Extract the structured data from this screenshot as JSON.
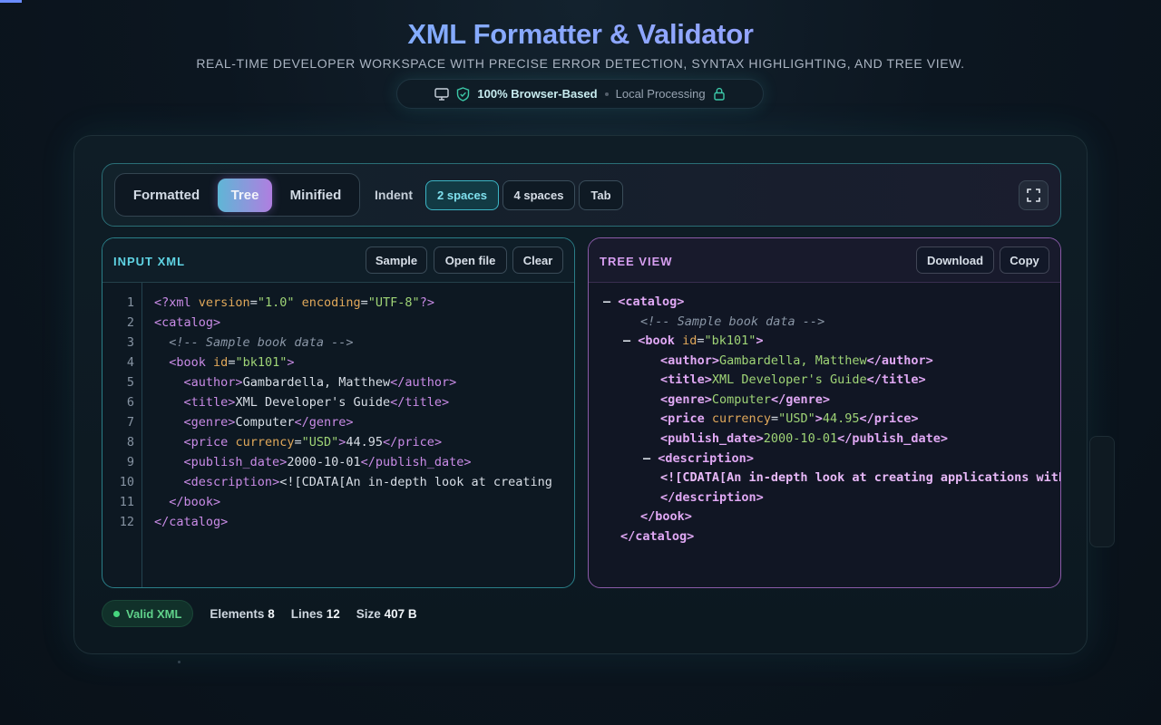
{
  "header": {
    "title": "XML Formatter & Validator",
    "subtitle": "REAL-TIME DEVELOPER WORKSPACE WITH PRECISE ERROR DETECTION, SYNTAX HIGHLIGHTING, AND TREE VIEW.",
    "badge_primary": "100% Browser-Based",
    "badge_secondary": "Local Processing"
  },
  "toolbar": {
    "modes": [
      "Formatted",
      "Tree",
      "Minified"
    ],
    "active_mode": "Tree",
    "indent_label": "Indent",
    "indent_options": [
      "2 spaces",
      "4 spaces",
      "Tab"
    ],
    "active_indent": "2 spaces"
  },
  "input_panel": {
    "title": "INPUT XML",
    "buttons": [
      "Sample",
      "Open file",
      "Clear"
    ],
    "line_numbers": [
      "1",
      "2",
      "3",
      "4",
      "5",
      "6",
      "7",
      "8",
      "9",
      "10",
      "11",
      "12"
    ],
    "lines": [
      "<?xml version=\"1.0\" encoding=\"UTF-8\"?>",
      "<catalog>",
      "  <!-- Sample book data -->",
      "  <book id=\"bk101\">",
      "    <author>Gambardella, Matthew</author>",
      "    <title>XML Developer's Guide</title>",
      "    <genre>Computer</genre>",
      "    <price currency=\"USD\">44.95</price>",
      "    <publish_date>2000-10-01</publish_date>",
      "    <description><![CDATA[An in-depth look at creating",
      "  </book>",
      "</catalog>"
    ]
  },
  "tree_panel": {
    "title": "TREE VIEW",
    "buttons": [
      "Download",
      "Copy"
    ],
    "nodes": {
      "catalog_open": "<catalog>",
      "comment": "<!-- Sample book data -->",
      "book_open_tag": "<book",
      "book_attr": "id",
      "book_attr_value": "\"bk101\"",
      "author_open": "<author>",
      "author_text": "Gambardella, Matthew",
      "author_close": "</author>",
      "title_open": "<title>",
      "title_text": "XML Developer's Guide",
      "title_close": "</title>",
      "genre_open": "<genre>",
      "genre_text": "Computer",
      "genre_close": "</genre>",
      "price_open_tag": "<price",
      "price_attr": "currency",
      "price_attr_value": "\"USD\"",
      "price_text": "44.95",
      "price_close": "</price>",
      "publish_open": "<publish_date>",
      "publish_text": "2000-10-01",
      "publish_close": "</publish_date>",
      "description_open": "<description>",
      "cdata": "<![CDATA[An in-depth look at creating applications with",
      "description_close": "</description>",
      "book_close": "</book>",
      "catalog_close": "</catalog>",
      "collapse_marker": "–"
    }
  },
  "status": {
    "valid_label": "Valid XML",
    "elements_label": "Elements",
    "elements_value": "8",
    "lines_label": "Lines",
    "lines_value": "12",
    "size_label": "Size",
    "size_value": "407 B"
  },
  "colors": {
    "accent_teal": "#5fd4e4",
    "accent_purple": "#d69ef0",
    "valid_green": "#46d67e"
  }
}
